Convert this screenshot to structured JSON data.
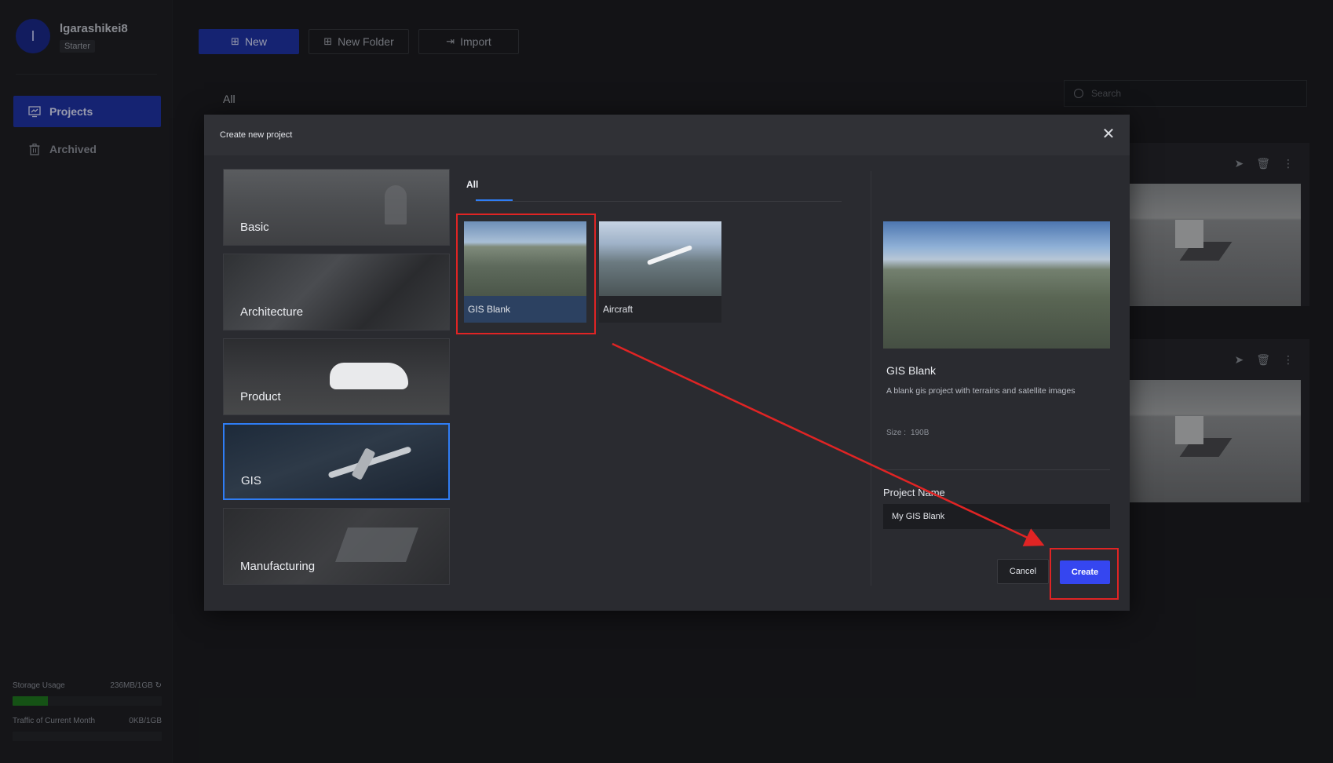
{
  "user": {
    "initial": "I",
    "name": "lgarashikei8",
    "plan": "Starter"
  },
  "nav": {
    "projects": "Projects",
    "archived": "Archived"
  },
  "storage": {
    "usage_label": "Storage Usage",
    "usage_value": "236MB/1GB",
    "usage_fraction": 0.236,
    "traffic_label": "Traffic of Current Month",
    "traffic_value": "0KB/1GB",
    "traffic_fraction": 0
  },
  "toolbar": {
    "new": "New",
    "new_folder": "New Folder",
    "import": "Import"
  },
  "filter": {
    "all": "All"
  },
  "search": {
    "placeholder": "Search"
  },
  "modal": {
    "title": "Create new project",
    "categories": [
      "Basic",
      "Architecture",
      "Product",
      "GIS",
      "Manufacturing"
    ],
    "selected_category": "GIS",
    "template_tab": "All",
    "templates": [
      "GIS Blank",
      "Aircraft"
    ],
    "selected_template": "GIS Blank",
    "preview": {
      "title": "GIS Blank",
      "description": "A blank gis project with terrains and satellite images",
      "size_label": "Size :",
      "size_value": "190B"
    },
    "project_name_label": "Project Name",
    "project_name_value": "My GIS Blank",
    "cancel": "Cancel",
    "create": "Create"
  },
  "colors": {
    "accent": "#2034a8",
    "create": "#3546f0",
    "highlight": "#e02424",
    "selection": "#2f7df4"
  },
  "icons": [
    "projects-icon",
    "archive-icon",
    "plus-icon",
    "folder-plus-icon",
    "import-icon",
    "search-icon",
    "send-icon",
    "trash-icon",
    "more-icon",
    "close-icon",
    "refresh-icon"
  ]
}
